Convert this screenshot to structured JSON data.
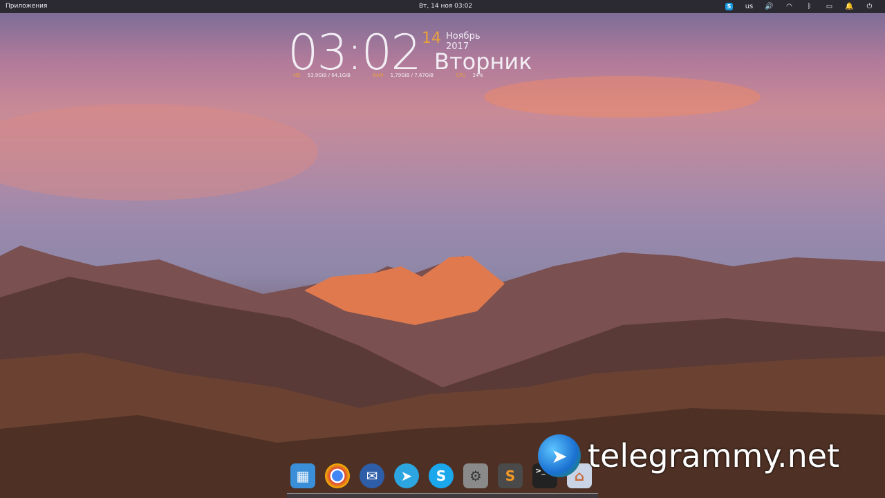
{
  "topbar": {
    "apps_label": "Приложения",
    "datetime": "Вт, 14 ноя   03:02",
    "tray": [
      {
        "icon": "skype-icon",
        "label": "S"
      },
      {
        "icon": "keyboard-layout",
        "label": "us"
      },
      {
        "icon": "volume-icon",
        "label": "🔊"
      },
      {
        "icon": "wifi-icon",
        "label": "◠"
      },
      {
        "icon": "bluetooth-icon",
        "label": "ᛒ"
      },
      {
        "icon": "battery-icon",
        "label": "▭"
      },
      {
        "icon": "bell-icon",
        "label": "🔔"
      },
      {
        "icon": "power-icon",
        "label": "⏻"
      }
    ]
  },
  "widget": {
    "time": "03:02",
    "day": "14",
    "month_year": "Ноябрь 2017",
    "weekday": "Вторник",
    "stats": [
      {
        "key": "HD",
        "value": "53,9GiB / 64,1GiB"
      },
      {
        "key": "RAM",
        "value": "1,79GiB / 7,67GiB"
      },
      {
        "key": "CPU",
        "value": "24%"
      }
    ]
  },
  "dock": [
    {
      "name": "workspaces",
      "glyph": "▦",
      "color": "#3b8fd8"
    },
    {
      "name": "chrome",
      "glyph": "◉",
      "color": "#db4437"
    },
    {
      "name": "thunderbird",
      "glyph": "✉",
      "color": "#2f5ea8"
    },
    {
      "name": "telegram",
      "glyph": "➤",
      "color": "#2ca5e0"
    },
    {
      "name": "skype",
      "glyph": "S",
      "color": "#1aa7ec"
    },
    {
      "name": "system-settings",
      "glyph": "⚙",
      "color": "#8a8a8a"
    },
    {
      "name": "sublime-text",
      "glyph": "S",
      "color": "#4a4a4a"
    },
    {
      "name": "terminal",
      "glyph": ">_",
      "color": "#222222"
    },
    {
      "name": "app-store",
      "glyph": "⌂",
      "color": "#c9d4e6"
    }
  ],
  "watermark": "telegrammy.net",
  "colors": {
    "topbar": "#2b2a33",
    "accent": "#e9a23b"
  }
}
